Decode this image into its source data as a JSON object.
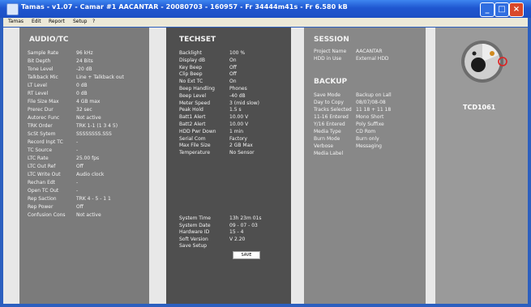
{
  "window": {
    "title": "Tamas - v1.07 - Camar #1   AACANTAR - 20080703 - 160957   - Fr 34444m41s - Fr 6.580 kB"
  },
  "menu": [
    "Tamas",
    "Edit",
    "Report",
    "Setup",
    "?"
  ],
  "audio_tc": {
    "title": "AUDIO/TC",
    "rows": [
      {
        "k": "Sample Rate",
        "v": "96 kHz"
      },
      {
        "k": "Bit Depth",
        "v": "24 Bits"
      },
      {
        "k": "Tone Level",
        "v": "-20 dB"
      },
      {
        "k": "Talkback Mic",
        "v": "Line + Talkback out"
      },
      {
        "k": "LT Level",
        "v": "0 dB"
      },
      {
        "k": "RT Level",
        "v": "0 dB"
      },
      {
        "k": "File Size Max",
        "v": "4 GB max"
      },
      {
        "k": "Prerec Dur",
        "v": "32 sec"
      },
      {
        "k": "Autorec Func",
        "v": "Not active"
      },
      {
        "k": "TRK Order",
        "v": "TRK 1-1 (1 3 4 5)"
      },
      {
        "k": "ScSt Sytem",
        "v": "SSSSSSSS.SSS"
      },
      {
        "k": "Record Inpt TC",
        "v": "-"
      },
      {
        "k": "TC Source",
        "v": "-"
      },
      {
        "k": "LTC Rate",
        "v": "25.00 fps"
      },
      {
        "k": "LTC Out Ref",
        "v": "Off"
      },
      {
        "k": "LTC Write Out",
        "v": "Audio clock"
      },
      {
        "k": "Rechan Edt",
        "v": "-"
      },
      {
        "k": "Open TC Out",
        "v": "-"
      },
      {
        "k": "Rep Saction",
        "v": "TRK 4 - 5 - 1 1"
      },
      {
        "k": "Rep Power",
        "v": "Off"
      },
      {
        "k": "Confusion Cons",
        "v": "Not active"
      }
    ]
  },
  "techset": {
    "title": "TECHSET",
    "rows": [
      {
        "k": "Backlight",
        "v": "100 %"
      },
      {
        "k": "Display dB",
        "v": "On"
      },
      {
        "k": "Key Beep",
        "v": "Off"
      },
      {
        "k": "Clip Beep",
        "v": "Off"
      },
      {
        "k": "No Ext TC",
        "v": "On"
      },
      {
        "k": "Beep Handling",
        "v": "Phones"
      },
      {
        "k": "Beep Level",
        "v": "-40 dB"
      },
      {
        "k": "Meter Speed",
        "v": "3 (mid slow)"
      },
      {
        "k": "Peak Hold",
        "v": "1.5 s"
      },
      {
        "k": "Batt1 Alert",
        "v": "10.00 V"
      },
      {
        "k": "Batt2 Alert",
        "v": "10.00 V"
      },
      {
        "k": "HDD Pwr Down",
        "v": "1 min"
      },
      {
        "k": "Serial Com",
        "v": "Factory"
      },
      {
        "k": "Max File Size",
        "v": "2 GB Max"
      },
      {
        "k": "Temperature",
        "v": "No Sensor"
      }
    ],
    "sys_rows": [
      {
        "k": "System Time",
        "v": "13h 23m 01s"
      },
      {
        "k": "System Date",
        "v": "09 - 07 - 03"
      },
      {
        "k": "Hardware ID",
        "v": "15 - 4"
      },
      {
        "k": "Soft Version",
        "v": "V 2.20"
      },
      {
        "k": "Save Setup",
        "v": ""
      }
    ],
    "save_button": "SAVE"
  },
  "session": {
    "title": "SESSION",
    "rows": [
      {
        "k": "Project Name",
        "v": "AACANTAR"
      },
      {
        "k": "HDD in Use",
        "v": "External HDD"
      }
    ]
  },
  "backup": {
    "title": "BACKUP",
    "rows": [
      {
        "k": "Save Mode",
        "v": "Backup on Lall"
      },
      {
        "k": "Day to Copy",
        "v": "08/07/08-08"
      },
      {
        "k": "Tracks Selected",
        "v": "11 18 + 11 18"
      },
      {
        "k": "11-16 Entered",
        "v": "Mono Short"
      },
      {
        "k": "Y/16 Entered",
        "v": "Poly Suffixe"
      },
      {
        "k": "Media Type",
        "v": "CD Rom"
      },
      {
        "k": "Burn Mode",
        "v": "Burn only"
      },
      {
        "k": "Verbose",
        "v": "Messaging"
      },
      {
        "k": "Media Label",
        "v": ""
      }
    ]
  },
  "device": {
    "label": "TCD1061",
    "accent": "#e02020"
  }
}
